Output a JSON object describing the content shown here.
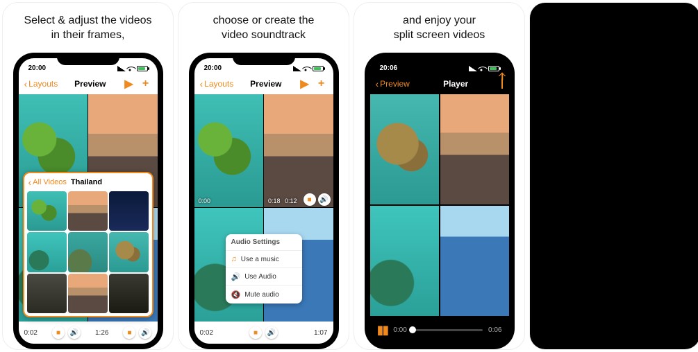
{
  "captions": [
    "Select & adjust the videos\nin their frames,",
    "choose or create the\nvideo soundtrack",
    "and enjoy your\nsplit screen videos",
    ""
  ],
  "accent": "#ef8a1f",
  "shot1": {
    "status_time": "20:00",
    "nav_back": "Layouts",
    "nav_title": "Preview",
    "bottom_left": "0:02",
    "bottom_right": "1:26",
    "picker_back": "All Videos",
    "picker_title": "Thailand"
  },
  "shot2": {
    "status_time": "20:00",
    "nav_back": "Layouts",
    "nav_title": "Preview",
    "pane_tl_time": "0:00",
    "pane_tr_time_l": "0:18",
    "pane_tr_time_r": "0:12",
    "bottom_left": "0:02",
    "bottom_right": "1:07",
    "popover_head": "Audio Settings",
    "popover_items": [
      "Use a music",
      "Use Audio",
      "Mute audio"
    ]
  },
  "shot3": {
    "status_time": "20:06",
    "nav_back": "Preview",
    "nav_title": "Player",
    "time_cur": "0:00",
    "time_total": "0:06"
  }
}
